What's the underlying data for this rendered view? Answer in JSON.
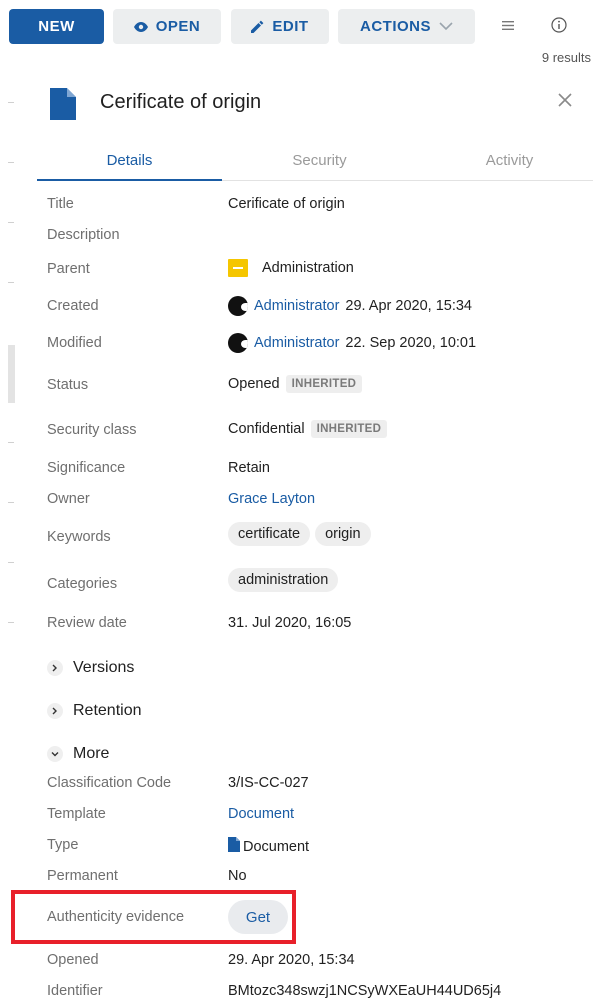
{
  "toolbar": {
    "new_label": "NEW",
    "open_label": "OPEN",
    "edit_label": "EDIT",
    "actions_label": "ACTIONS",
    "results": "9 results"
  },
  "panel": {
    "title": "Cerificate of origin",
    "tabs": [
      "Details",
      "Security",
      "Activity"
    ]
  },
  "details": {
    "title_label": "Title",
    "title_value": "Cerificate of origin",
    "description_label": "Description",
    "parent_label": "Parent",
    "parent_value": "Administration",
    "created_label": "Created",
    "created_user": "Administrator",
    "created_date": "29. Apr 2020, 15:34",
    "modified_label": "Modified",
    "modified_user": "Administrator",
    "modified_date": "22. Sep 2020, 10:01",
    "status_label": "Status",
    "status_value": "Opened",
    "status_badge": "INHERITED",
    "security_class_label": "Security class",
    "security_class_value": "Confidential",
    "security_class_badge": "INHERITED",
    "significance_label": "Significance",
    "significance_value": "Retain",
    "owner_label": "Owner",
    "owner_value": "Grace Layton",
    "keywords_label": "Keywords",
    "keywords": [
      "certificate",
      "origin"
    ],
    "categories_label": "Categories",
    "categories": [
      "administration"
    ],
    "review_date_label": "Review date",
    "review_date_value": "31. Jul 2020, 16:05"
  },
  "sections": {
    "versions": "Versions",
    "retention": "Retention",
    "more": "More"
  },
  "more": {
    "classification_code_label": "Classification Code",
    "classification_code_value": "3/IS-CC-027",
    "template_label": "Template",
    "template_value": "Document",
    "type_label": "Type",
    "type_value": "Document",
    "permanent_label": "Permanent",
    "permanent_value": "No",
    "authenticity_label": "Authenticity evidence",
    "authenticity_button": "Get",
    "opened_label": "Opened",
    "opened_value": "29. Apr 2020, 15:34",
    "identifier_label": "Identifier",
    "identifier_value": "BMtozc348swzj1NCSyWXEaUH44UD65j4"
  },
  "colors": {
    "primary": "#1a5ca4",
    "highlight": "#e8202a",
    "folder": "#f5c600"
  },
  "icons": [
    "eye-icon",
    "pencil-icon",
    "chevron-down-icon",
    "list-icon",
    "info-icon",
    "document-icon",
    "close-icon",
    "folder-icon",
    "avatar-icon",
    "chevron-right-icon"
  ]
}
